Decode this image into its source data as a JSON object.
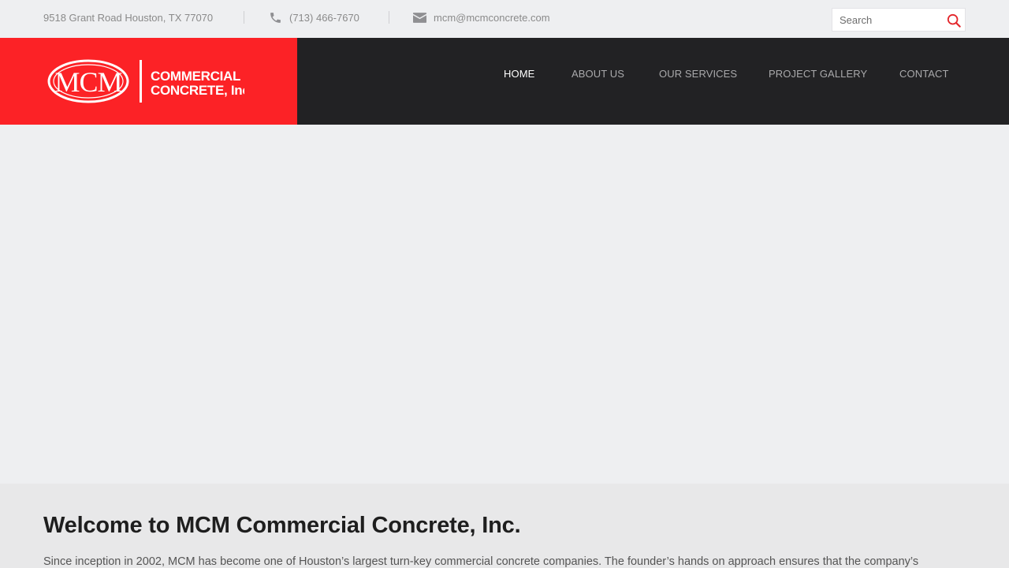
{
  "topbar": {
    "address": "9518 Grant Road Houston, TX 77070",
    "phone": "(713) 466-7670",
    "email": "mcm@mcmconcrete.com",
    "phone_icon": "phone-icon",
    "email_icon": "envelope-icon",
    "search": {
      "placeholder": "Search",
      "value": "",
      "icon": "search-icon"
    }
  },
  "header": {
    "logo": {
      "monogram": "MCM",
      "line1": "COMMERCIAL",
      "line2": "CONCRETE, Inc."
    },
    "nav": [
      {
        "label": "HOME",
        "active": true
      },
      {
        "label": "ABOUT US",
        "active": false
      },
      {
        "label": "OUR SERVICES",
        "active": false
      },
      {
        "label": "PROJECT GALLERY",
        "active": false
      },
      {
        "label": "CONTACT",
        "active": false
      }
    ]
  },
  "welcome": {
    "title": "Welcome to MCM Commercial Concrete, Inc.",
    "intro": "Since inception in 2002, MCM has become one of Houston’s largest turn-key commercial concrete companies. The founder’s hands on approach ensures that the company’s"
  },
  "colors": {
    "brand_red": "#fc2226",
    "header_dark": "#222224",
    "topbar_bg": "#eeeff1",
    "search_icon": "#e3262b"
  }
}
